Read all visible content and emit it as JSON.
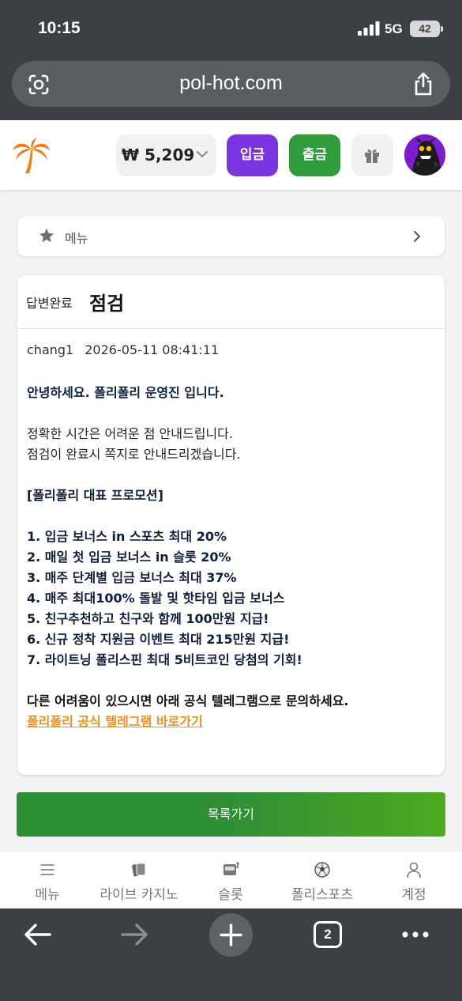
{
  "status_bar": {
    "time": "10:15",
    "network": "5G",
    "battery": "42"
  },
  "browser": {
    "url": "pol-hot.com",
    "tab_count": "2"
  },
  "header": {
    "balance": "₩ 5,209",
    "deposit_label": "입금",
    "withdraw_label": "출금"
  },
  "menu": {
    "label": "메뉴"
  },
  "post": {
    "status": "답변완료",
    "title": "점검",
    "author": "chang1",
    "datetime": "2026-05-11 08:41:11",
    "greeting": "안녕하세요. 폴리폴리 운영진 입니다.",
    "line1": "정확한 시간은 어려운 점 안내드립니다.",
    "line2": "점검이 완료시 쪽지로 안내드리겠습니다.",
    "promo_heading": "[폴리폴리 대표 프로모션]",
    "promos": [
      "1. 입금 보너스 in 스포츠 최대 20%",
      "2. 매일 첫 입금 보너스 in 슬롯 20%",
      "3. 매주 단계별 입금 보너스 최대 37%",
      "4. 매주 최대100% 돌발 및 핫타임 입금 보너스",
      "5. 친구추천하고 친구와 함께 100만원 지급!",
      "6. 신규 정착 지원금 이벤트 최대 215만원 지급!",
      "7. 라이트닝 폴리스핀 최대 5비트코인 당첨의 기회!"
    ],
    "ask": "다른 어려움이 있으시면 아래 공식 텔레그램으로 문의하세요.",
    "telegram_link": "폴리폴리 공식 텔레그램 바로가기"
  },
  "list_button": "목록가기",
  "bottom_nav": [
    {
      "label": "메뉴",
      "icon": "hamburger-icon"
    },
    {
      "label": "라이브 카지노",
      "icon": "cards-icon"
    },
    {
      "label": "슬롯",
      "icon": "slot-machine-icon"
    },
    {
      "label": "폴리스포츠",
      "icon": "soccer-ball-icon"
    },
    {
      "label": "계정",
      "icon": "user-icon"
    }
  ],
  "colors": {
    "deposit": "#7b34e0",
    "withdraw": "#2f9b3a",
    "link": "#f0901d",
    "list_button": "#2f8f35"
  }
}
